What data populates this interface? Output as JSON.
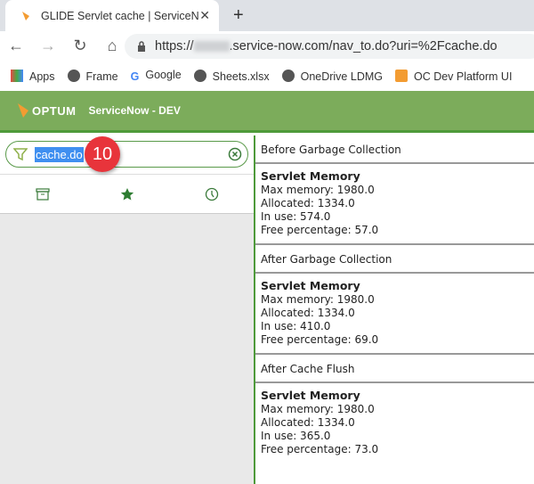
{
  "browser": {
    "tab_title": "GLIDE Servlet cache | ServiceNow",
    "close": "✕",
    "new_tab": "+",
    "url_prefix": "https://",
    "url_suffix": ".service-now.com/nav_to.do?uri=%2Fcache.do",
    "nav": {
      "back": "←",
      "forward": "→",
      "reload": "↻",
      "home": "⌂"
    },
    "bookmarks": [
      {
        "label": "Apps",
        "icon": "apps-grid-icon"
      },
      {
        "label": "Frame",
        "icon": "globe-icon"
      },
      {
        "label": "Google",
        "icon": "google-icon"
      },
      {
        "label": "Sheets.xlsx",
        "icon": "globe-icon"
      },
      {
        "label": "OneDrive LDMG",
        "icon": "globe-icon"
      },
      {
        "label": "OC Dev Platform UI",
        "icon": "servicenow-icon"
      }
    ]
  },
  "header": {
    "logo": "OPTUM",
    "env": "ServiceNow - DEV",
    "color": "#7cac5b"
  },
  "navigator": {
    "filter_value": "cache.do",
    "badge": "10",
    "badge_color": "#e8343b"
  },
  "sections": [
    {
      "heading": "Before Garbage Collection",
      "title": "Servlet Memory",
      "lines": [
        "Max memory: 1980.0",
        "Allocated: 1334.0",
        "In use: 574.0",
        "Free percentage: 57.0"
      ]
    },
    {
      "heading": "After Garbage Collection",
      "title": "Servlet Memory",
      "lines": [
        "Max memory: 1980.0",
        "Allocated: 1334.0",
        "In use: 410.0",
        "Free percentage: 69.0"
      ]
    },
    {
      "heading": "After Cache Flush",
      "title": "Servlet Memory",
      "lines": [
        "Max memory: 1980.0",
        "Allocated: 1334.0",
        "In use: 365.0",
        "Free percentage: 73.0"
      ]
    }
  ]
}
